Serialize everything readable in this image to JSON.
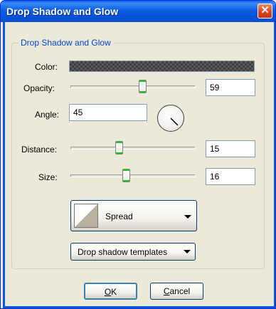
{
  "window": {
    "title": "Drop Shadow and Glow",
    "close_glyph": "✕"
  },
  "group": {
    "legend": "Drop Shadow and Glow"
  },
  "color": {
    "label": "Color:"
  },
  "opacity": {
    "label": "Opacity:",
    "value": "59"
  },
  "angle": {
    "label": "Angle:",
    "value": "45"
  },
  "distance": {
    "label": "Distance:",
    "value": "15"
  },
  "size": {
    "label": "Size:",
    "value": "16"
  },
  "spread": {
    "label": "Spread"
  },
  "templates": {
    "label": "Drop shadow templates"
  },
  "buttons": {
    "ok_mnemonic": "O",
    "ok_rest": "K",
    "cancel_mnemonic": "C",
    "cancel_rest": "ancel"
  },
  "colors": {
    "title_bar": "#0a5ee8",
    "group_legend": "#0046d5",
    "slider_accent": "#21c12b",
    "close_button": "#d9401c"
  }
}
